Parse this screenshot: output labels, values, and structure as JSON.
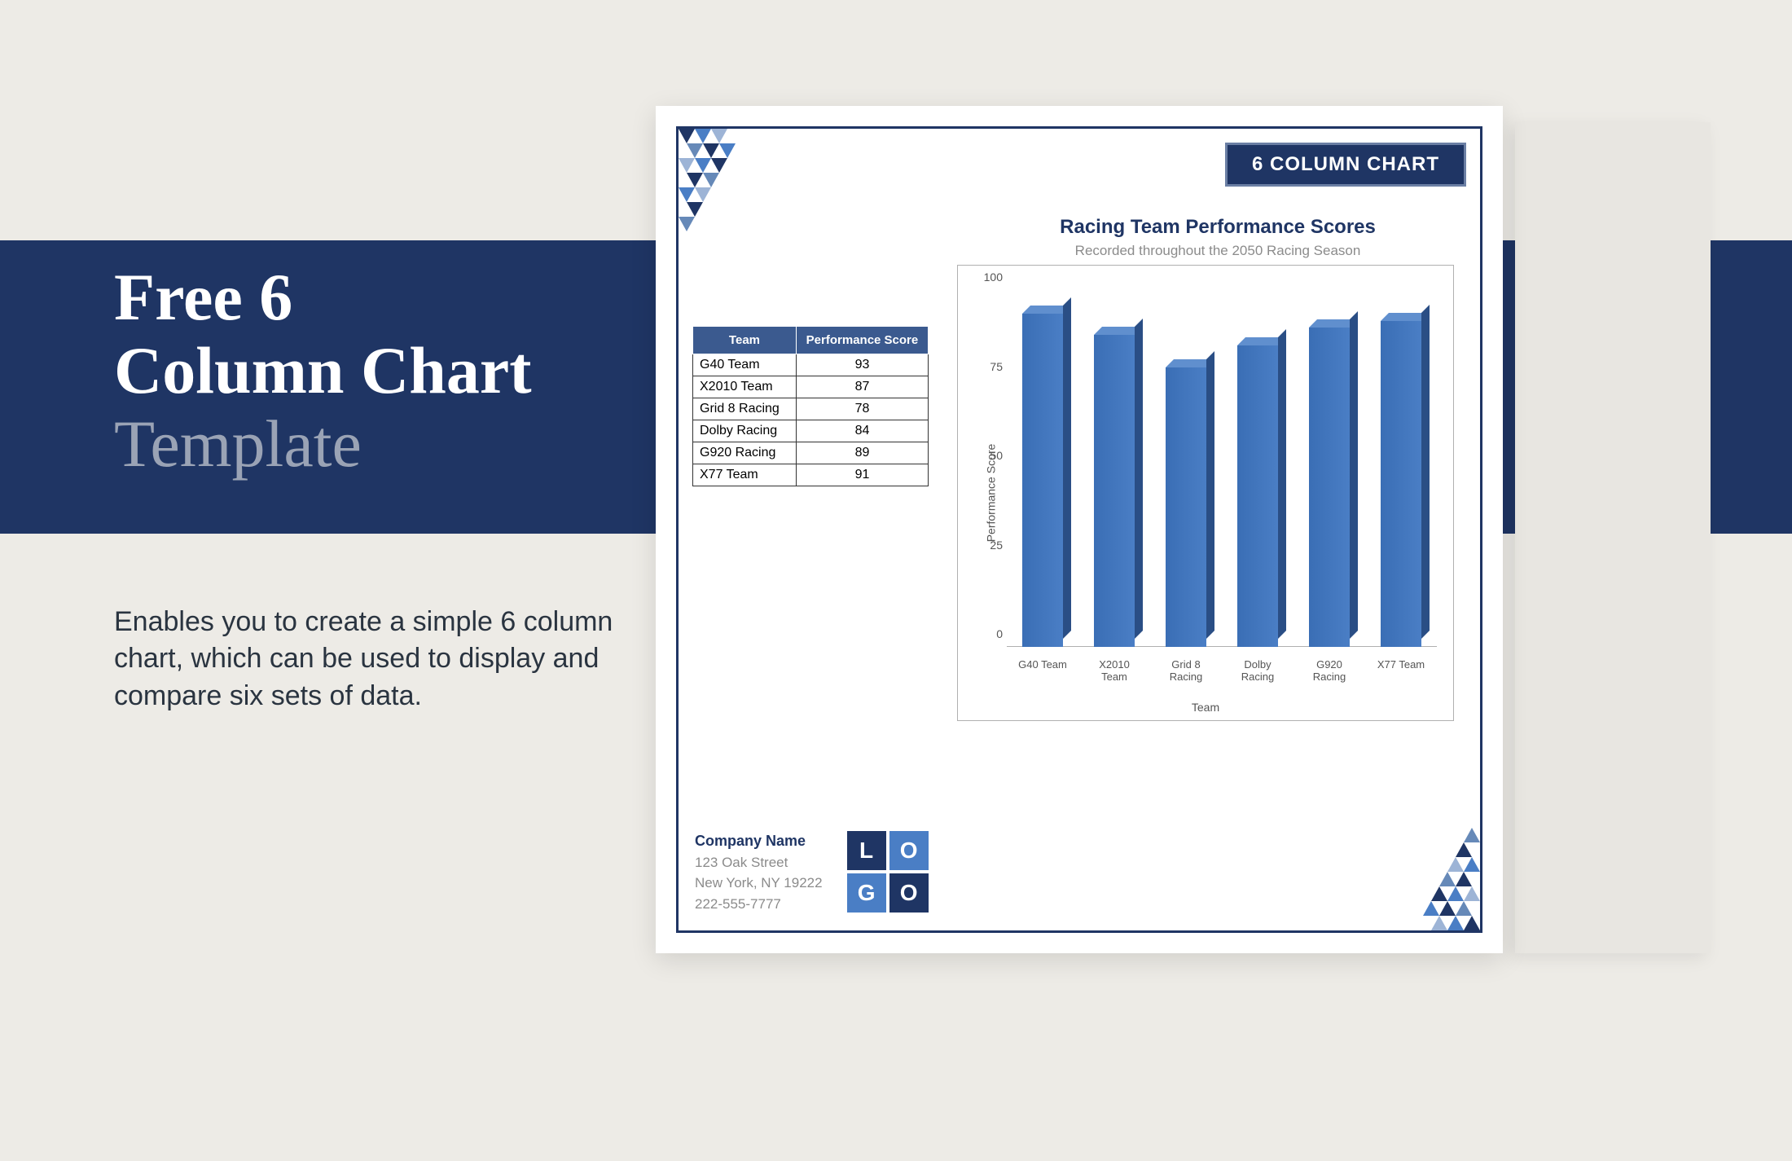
{
  "left": {
    "title_line1": "Free 6",
    "title_line2": "Column Chart",
    "title_line3": "Template",
    "description": "Enables you to create a  simple 6 column chart, which can be used to display and compare six sets of data."
  },
  "doc": {
    "badge": "6 COLUMN CHART",
    "chart_title": "Racing Team Performance Scores",
    "chart_subtitle": "Recorded throughout the 2050 Racing Season",
    "table": {
      "header_team": "Team",
      "header_score": "Performance Score",
      "rows": [
        {
          "team": "G40 Team",
          "score": "93"
        },
        {
          "team": "X2010 Team",
          "score": "87"
        },
        {
          "team": "Grid 8 Racing",
          "score": "78"
        },
        {
          "team": "Dolby Racing",
          "score": "84"
        },
        {
          "team": "G920 Racing",
          "score": "89"
        },
        {
          "team": "X77 Team",
          "score": "91"
        }
      ]
    },
    "chart": {
      "ylabel": "Performance Score",
      "xlabel": "Team",
      "ticks": [
        "0",
        "25",
        "50",
        "75",
        "100"
      ],
      "categories": [
        "G40 Team",
        "X2010 Team",
        "Grid 8 Racing",
        "Dolby Racing",
        "G920 Racing",
        "X77 Team"
      ]
    },
    "footer": {
      "company": "Company Name",
      "addr1": "123 Oak Street",
      "addr2": "New York, NY 19222",
      "phone": "222-555-7777",
      "logo": {
        "c1": "L",
        "c2": "O",
        "c3": "G",
        "c4": "O"
      }
    }
  },
  "chart_data": {
    "type": "bar",
    "title": "Racing Team Performance Scores",
    "subtitle": "Recorded throughout the 2050 Racing Season",
    "xlabel": "Team",
    "ylabel": "Performance Score",
    "ylim": [
      0,
      100
    ],
    "yticks": [
      0,
      25,
      50,
      75,
      100
    ],
    "categories": [
      "G40 Team",
      "X2010 Team",
      "Grid 8 Racing",
      "Dolby Racing",
      "G920 Racing",
      "X77 Team"
    ],
    "values": [
      93,
      87,
      78,
      84,
      89,
      91
    ]
  }
}
